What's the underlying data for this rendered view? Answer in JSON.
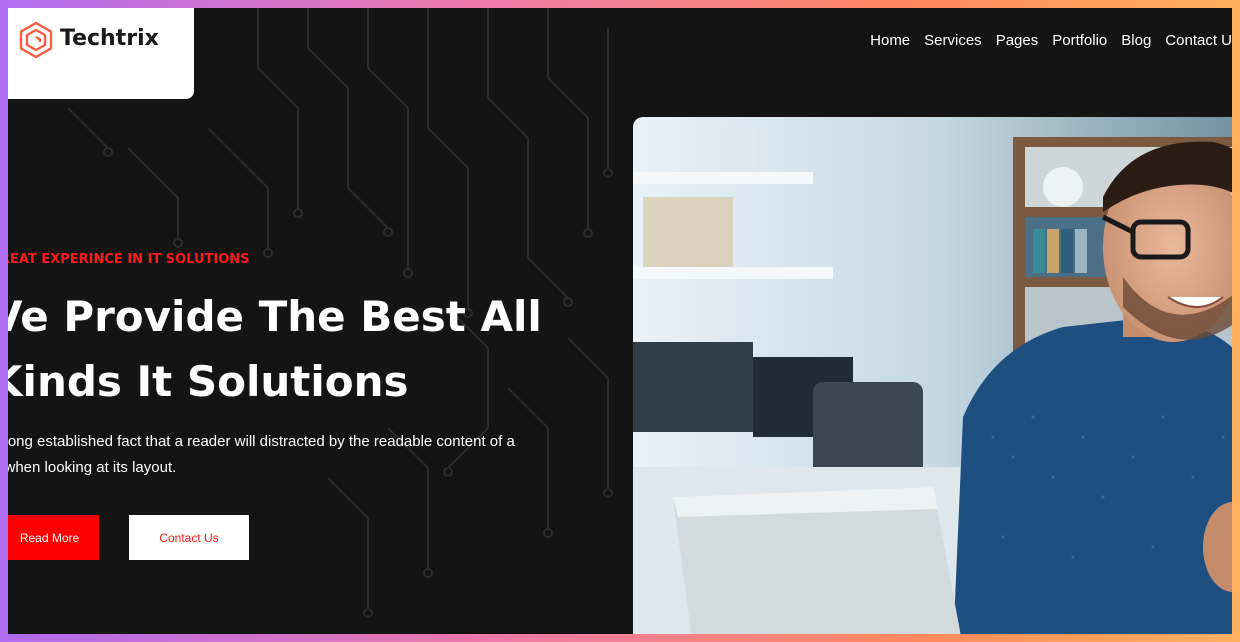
{
  "brand": {
    "name": "Techtrix",
    "logo_icon": "hexagon-logo-icon",
    "accent": "#ff0000"
  },
  "nav": {
    "items": [
      {
        "label": "Home"
      },
      {
        "label": "Services"
      },
      {
        "label": "Pages"
      },
      {
        "label": "Portfolio"
      },
      {
        "label": "Blog"
      },
      {
        "label": "Contact U"
      }
    ]
  },
  "hero": {
    "tagline": "REAT EXPERINCE IN IT SOLUTIONS",
    "headline_line1": "Ve Provide The Best All",
    "headline_line2": "Kinds It Solutions",
    "desc_line1": "a long established fact that a reader will distracted by the readable content of a",
    "desc_line2": "e when looking at its layout.",
    "read_more_label": "Read More",
    "contact_label": "Contact Us",
    "image": "photo of smiling man with glasses in blue shirt using laptop in office"
  }
}
